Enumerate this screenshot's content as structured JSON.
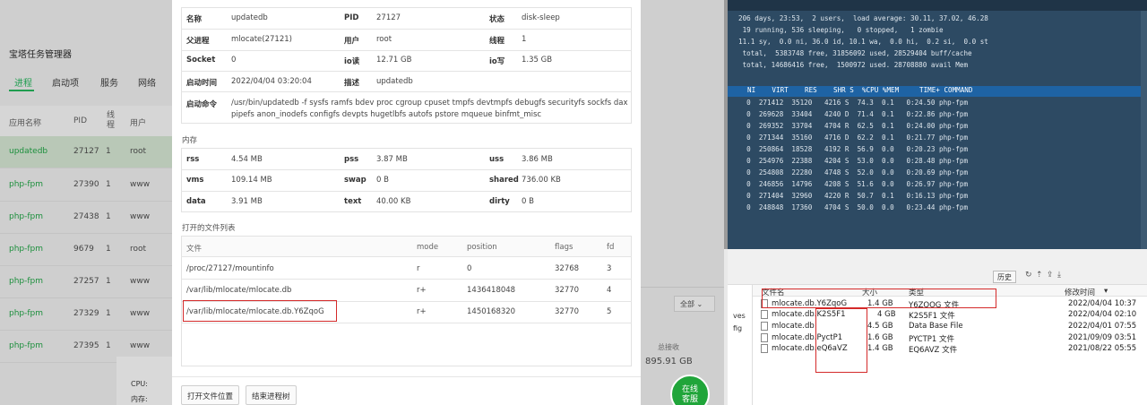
{
  "left_panel": {
    "title": "宝塔任务管理器",
    "tabs": [
      "进程",
      "启动项",
      "服务",
      "网络"
    ],
    "columns": [
      "应用名称",
      "PID",
      "线程",
      "用户"
    ],
    "rows": [
      {
        "name": "updatedb",
        "pid": "27127",
        "threads": "1",
        "user": "root"
      },
      {
        "name": "php-fpm",
        "pid": "27390",
        "threads": "1",
        "user": "www"
      },
      {
        "name": "php-fpm",
        "pid": "27438",
        "threads": "1",
        "user": "www"
      },
      {
        "name": "php-fpm",
        "pid": "9679",
        "threads": "1",
        "user": "root"
      },
      {
        "name": "php-fpm",
        "pid": "27257",
        "threads": "1",
        "user": "www"
      },
      {
        "name": "php-fpm",
        "pid": "27329",
        "threads": "1",
        "user": "www"
      },
      {
        "name": "php-fpm",
        "pid": "27395",
        "threads": "1",
        "user": "www"
      }
    ],
    "bottom": {
      "cpu": "CPU:",
      "mem": "内存:"
    }
  },
  "dialog": {
    "info": {
      "name_label": "名称",
      "name": "updatedb",
      "pid_label": "PID",
      "pid": "27127",
      "status_label": "状态",
      "status": "disk-sleep",
      "parent_label": "父进程",
      "parent": "mlocate(27121)",
      "user_label": "用户",
      "user": "root",
      "threads_label": "线程",
      "threads": "1",
      "socket_label": "Socket",
      "socket": "0",
      "io_read_label": "io读",
      "io_read": "12.71 GB",
      "io_write_label": "io写",
      "io_write": "1.35 GB",
      "start_label": "启动时间",
      "start": "2022/04/04 03:20:04",
      "desc_label": "描述",
      "desc": "updatedb",
      "cmd_label": "启动命令",
      "cmd_line1": "/usr/bin/updatedb -f sysfs ramfs bdev proc cgroup cpuset tmpfs devtmpfs debugfs securityfs sockfs dax",
      "cmd_line2": "pipefs anon_inodefs configfs devpts hugetlbfs autofs pstore mqueue binfmt_misc"
    },
    "memory_title": "内存",
    "memory": {
      "rss_label": "rss",
      "rss": "4.54 MB",
      "pss_label": "pss",
      "pss": "3.87 MB",
      "uss_label": "uss",
      "uss": "3.86 MB",
      "vms_label": "vms",
      "vms": "109.14 MB",
      "swap_label": "swap",
      "swap": "0 B",
      "shared_label": "shared",
      "shared": "736.00 KB",
      "data_label": "data",
      "data": "3.91 MB",
      "text_label": "text",
      "text": "40.00 KB",
      "dirty_label": "dirty",
      "dirty": "0 B"
    },
    "files_title": "打开的文件列表",
    "files_columns": [
      "文件",
      "mode",
      "position",
      "flags",
      "fd"
    ],
    "files": [
      {
        "path": "/proc/27127/mountinfo",
        "mode": "r",
        "position": "0",
        "flags": "32768",
        "fd": "3"
      },
      {
        "path": "/var/lib/mlocate/mlocate.db",
        "mode": "r+",
        "position": "1436418048",
        "flags": "32770",
        "fd": "4"
      },
      {
        "path": "/var/lib/mlocate/mlocate.db.Y6ZqoG",
        "mode": "r+",
        "position": "1450168320",
        "flags": "32770",
        "fd": "5"
      }
    ],
    "buttons": {
      "open_location": "打开文件位置",
      "end_tree": "结束进程树"
    }
  },
  "shade": {
    "select": "全部",
    "total_label": "总接收",
    "total_value": "895.91 GB",
    "online": "在线\n客服"
  },
  "terminal": {
    "lines": [
      "206 days, 23:53,  2 users,  load average: 30.11, 37.02, 46.28",
      " 19 running, 536 sleeping,   0 stopped,   1 zombie",
      "11.1 sy,  0.0 ni, 36.0 id, 10.1 wa,  0.0 hi,  0.2 si,  0.0 st",
      " total,  5383748 free, 31856092 used, 28529404 buff/cache",
      " total, 14686416 free,  1500972 used. 28708880 avail Mem"
    ],
    "header": "NI    VIRT    RES    SHR S  %CPU %MEM     TIME+ COMMAND",
    "procs": [
      "  0  271412  35120   4216 S  74.3  0.1   0:24.50 php-fpm",
      "  0  269628  33404   4240 D  71.4  0.1   0:22.86 php-fpm",
      "  0  269352  33704   4704 R  62.5  0.1   0:24.00 php-fpm",
      "  0  271344  35160   4716 D  62.2  0.1   0:21.77 php-fpm",
      "  0  250864  18528   4192 R  56.9  0.0   0:20.23 php-fpm",
      "  0  254976  22388   4204 S  53.0  0.0   0:28.48 php-fpm",
      "  0  254808  22280   4748 S  52.0  0.0   0:20.69 php-fpm",
      "  0  246856  14796   4208 S  51.6  0.0   0:26.97 php-fpm",
      "  0  271404  32960   4220 R  50.7  0.1   0:16.13 php-fpm",
      "  0  248848  17360   4704 S  50.0  0.0   0:23.44 php-fpm"
    ]
  },
  "explorer": {
    "history": "历史",
    "left_items": [
      "ves",
      "fig"
    ],
    "columns": [
      "文件名",
      "大小",
      "类型",
      "修改时间"
    ],
    "rows": [
      {
        "name": "mlocate.db.Y6ZqoG",
        "size": "1.4 GB",
        "type": "Y6ZQOG 文件",
        "date": "2022/04/04 10:37"
      },
      {
        "name": "mlocate.db.K2S5F1",
        "size": "4 GB",
        "type": "K2S5F1 文件",
        "date": "2022/04/04 02:10"
      },
      {
        "name": "mlocate.db",
        "size": "4.5 GB",
        "type": "Data Base File",
        "date": "2022/04/01 07:55"
      },
      {
        "name": "mlocate.db.PyctP1",
        "size": "1.6 GB",
        "type": "PYCTP1 文件",
        "date": "2021/09/09 03:51"
      },
      {
        "name": "mlocate.db.eQ6aVZ",
        "size": "1.4 GB",
        "type": "EQ6AVZ 文件",
        "date": "2021/08/22 05:55"
      }
    ]
  }
}
